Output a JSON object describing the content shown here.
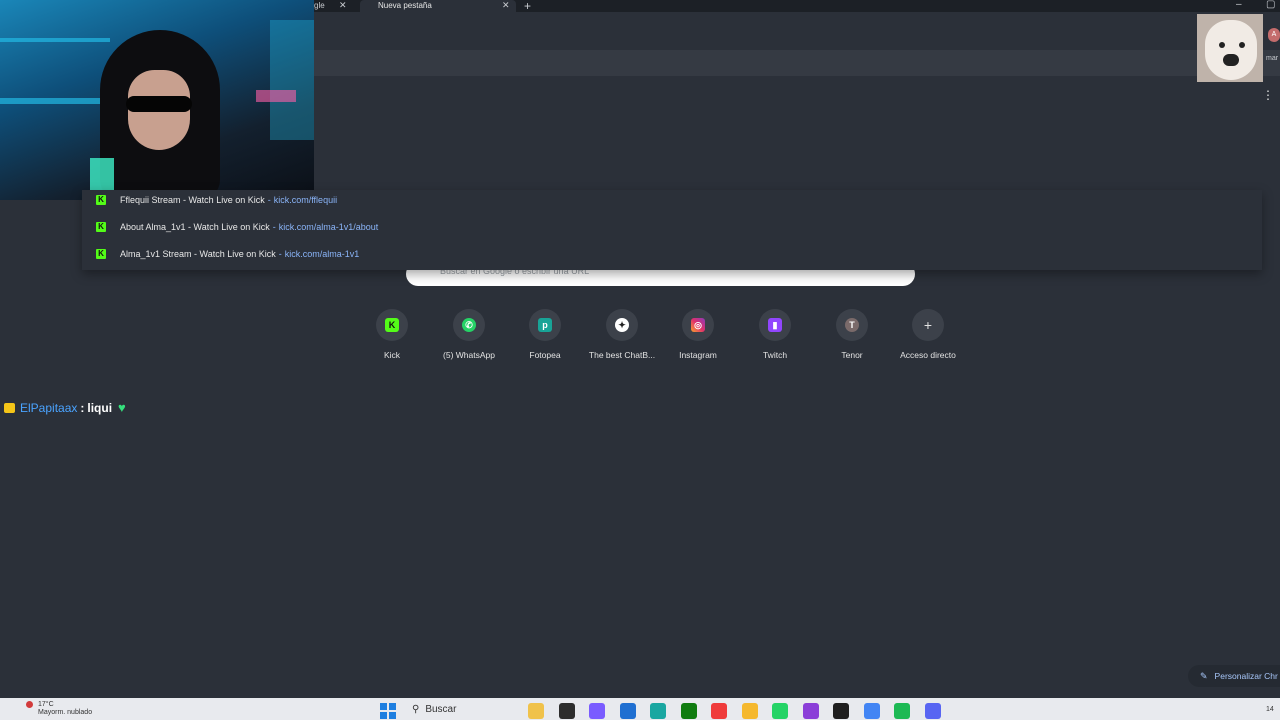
{
  "browser": {
    "tabs": [
      {
        "label": "gle",
        "active": false
      },
      {
        "label": "Nueva pestaña",
        "active": true
      }
    ],
    "new_tab_icon": "plus-icon",
    "window_controls": [
      "minimize-icon",
      "maximize-icon"
    ],
    "profile_initial": "A",
    "profile_name": "mar"
  },
  "search": {
    "placeholder": "Buscar en Google o escribir una URL"
  },
  "suggestions": [
    {
      "title": "Fflequii Stream - Watch Live on Kick",
      "url": "kick.com/fflequii",
      "icon": "kick-icon"
    },
    {
      "title": "About Alma_1v1 - Watch Live on Kick",
      "url": "kick.com/alma-1v1/about",
      "icon": "kick-icon"
    },
    {
      "title": "Alma_1v1 Stream - Watch Live on Kick",
      "url": "kick.com/alma-1v1",
      "icon": "kick-icon"
    }
  ],
  "shortcuts": [
    {
      "label": "Kick",
      "icon": "kick-icon",
      "color": "#53fc18"
    },
    {
      "label": "(5) WhatsApp",
      "icon": "whatsapp-icon",
      "color": "#25d366"
    },
    {
      "label": "Fotopea",
      "icon": "photopea-icon",
      "color": "#18a497"
    },
    {
      "label": "The best ChatB...",
      "icon": "chatbot-icon",
      "color": "#ffffff"
    },
    {
      "label": "Instagram",
      "icon": "instagram-icon",
      "color": "#e1306c"
    },
    {
      "label": "Twitch",
      "icon": "twitch-icon",
      "color": "#9146ff"
    },
    {
      "label": "Tenor",
      "icon": "tenor-icon",
      "color": "#7a6a6a"
    },
    {
      "label": "Acceso directo",
      "icon": "plus-icon",
      "color": "#e3e3e3"
    }
  ],
  "chat": {
    "username": "ElPapitaax",
    "separator": ":",
    "message": "liqui",
    "emote": "♥"
  },
  "customize": {
    "label": "Personalizar Chr"
  },
  "taskbar": {
    "temperature": "17°C",
    "weather": "Mayorm. nublado",
    "search_label": "Buscar",
    "time": "14",
    "apps": [
      {
        "name": "explorer-icon",
        "color": "#f0c24a"
      },
      {
        "name": "terminal-icon",
        "color": "#2d2d2d"
      },
      {
        "name": "copilot-icon",
        "color": "#7a5cff"
      },
      {
        "name": "store-icon",
        "color": "#1f6fd1"
      },
      {
        "name": "edge-icon",
        "color": "#1aa7a1"
      },
      {
        "name": "xbox-icon",
        "color": "#107c10"
      },
      {
        "name": "opera-gx-icon",
        "color": "#ef3b3b"
      },
      {
        "name": "folder-icon",
        "color": "#f5b82e"
      },
      {
        "name": "whatsapp-icon",
        "color": "#25d366"
      },
      {
        "name": "app-circle-icon",
        "color": "#8b3fd8"
      },
      {
        "name": "obs-icon",
        "color": "#1f1f1f"
      },
      {
        "name": "chrome-icon",
        "color": "#4285f4"
      },
      {
        "name": "spotify-icon",
        "color": "#1db954"
      },
      {
        "name": "discord-icon",
        "color": "#5865f2"
      }
    ]
  }
}
